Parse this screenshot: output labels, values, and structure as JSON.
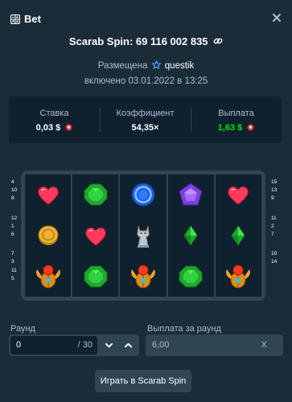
{
  "header": {
    "title": "Bet",
    "icons": [
      "bet-slip-icon",
      "close-icon"
    ]
  },
  "bet": {
    "title": "Scarab Spin: 69 116 002 835",
    "placed_label": "Размещена",
    "username": "questik",
    "included": "включено 03.01.2022 в 13:25"
  },
  "stats": {
    "stake_label": "Ставка",
    "stake_value": "0,03 $",
    "multiplier_label": "Коэффициент",
    "multiplier_value": "54,35×",
    "payout_label": "Выплата",
    "payout_value": "1,63 $"
  },
  "paylines": {
    "left": [
      [
        "4",
        "10",
        "8"
      ],
      [
        "12",
        "1",
        "6"
      ],
      [
        "7",
        "3",
        "11",
        "5"
      ]
    ],
    "right": [
      [
        "15",
        "13",
        "9"
      ],
      [
        "11",
        "2",
        "7"
      ],
      [
        "10",
        "14"
      ]
    ]
  },
  "reels": [
    [
      "heart",
      "coin",
      "scarab"
    ],
    [
      "emerald",
      "heart",
      "emerald"
    ],
    [
      "blue-gem",
      "cat-statue",
      "scarab"
    ],
    [
      "purple-gem",
      "green-diamond",
      "emerald"
    ],
    [
      "heart",
      "green-diamond",
      "scarab"
    ]
  ],
  "round": {
    "label": "Раунд",
    "value": "0",
    "max": "/ 30"
  },
  "round_payout": {
    "label": "Выплата за раунд",
    "value": "6,00",
    "suffix": "X"
  },
  "play_button": "Играть в Scarab Spin",
  "colors": {
    "background": "#1a2c38",
    "panel": "#0f212e",
    "control": "#2f4553",
    "muted_text": "#b1bad3",
    "win_green": "#00e701",
    "currency_red": "#e0223a"
  }
}
